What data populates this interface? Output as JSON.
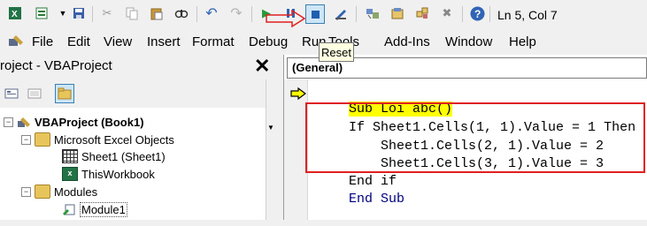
{
  "toolbar": {
    "status": "Ln 5, Col 7",
    "icons": [
      "excel-icon",
      "insert-module-icon",
      "save-icon",
      "cut-icon",
      "copy-icon",
      "paste-icon",
      "find-icon",
      "undo-icon",
      "redo-icon",
      "run-icon",
      "break-icon",
      "reset-icon",
      "design-mode-icon",
      "project-explorer-icon",
      "properties-icon",
      "object-browser-icon",
      "toolbox-icon",
      "help-icon"
    ]
  },
  "menu": {
    "items": [
      "File",
      "Edit",
      "View",
      "Insert",
      "Format",
      "Debug",
      "Run",
      "Tools",
      "Add-Ins",
      "Window",
      "Help"
    ]
  },
  "tooltip": {
    "text": "Reset"
  },
  "project_panel": {
    "title": "roject - VBAProject",
    "close": "✕",
    "tree": [
      {
        "label": "VBAProject (Book1)",
        "bold": true
      },
      {
        "label": "Microsoft Excel Objects"
      },
      {
        "label": "Sheet1 (Sheet1)"
      },
      {
        "label": "ThisWorkbook"
      },
      {
        "label": "Modules"
      },
      {
        "label": "Module1"
      }
    ]
  },
  "code_window": {
    "object_combo": "(General)",
    "lines": [
      "Sub Loi abc()",
      "If Sheet1.Cells(1, 1).Value = 1 Then",
      "    Sheet1.Cells(2, 1).Value = 2",
      "    Sheet1.Cells(3, 1).Value = 3",
      "End if",
      "End Sub"
    ]
  },
  "colors": {
    "highlight": "#ffff00",
    "annotation": "#e02020",
    "keyword": "#000080"
  }
}
